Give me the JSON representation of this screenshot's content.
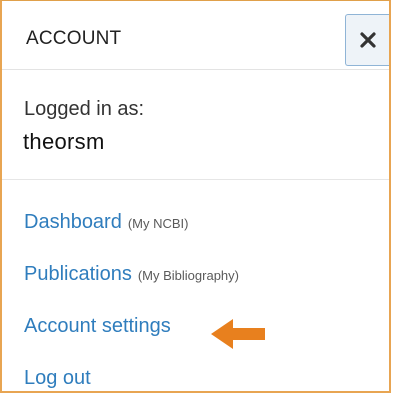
{
  "header": {
    "title": "ACCOUNT",
    "close_icon": "close-icon"
  },
  "account": {
    "logged_in_label": "Logged in as:",
    "username": "theorsm"
  },
  "menu": {
    "items": [
      {
        "label": "Dashboard",
        "note": "(My NCBI)"
      },
      {
        "label": "Publications",
        "note": "(My Bibliography)"
      },
      {
        "label": "Account settings",
        "note": ""
      },
      {
        "label": "Log out",
        "note": ""
      }
    ]
  },
  "annotation": {
    "icon": "arrow-left-icon",
    "color": "#e8801e"
  },
  "colors": {
    "link": "#2f7dbd",
    "border": "#e8a552",
    "close_button_bg": "#eef3f8",
    "close_button_border": "#8fb4d6"
  }
}
